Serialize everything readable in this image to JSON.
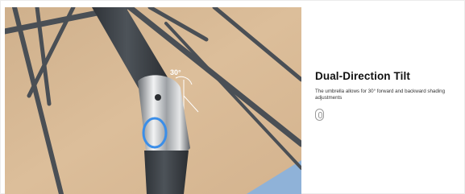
{
  "feature": {
    "title": "Dual-Direction Tilt",
    "description": "The umbrella allows for 30° forward and backward shading adjustments",
    "toggle_icon": "switch-toggle-icon"
  },
  "photo": {
    "angle_label": "30°",
    "canopy_color": "#d8b893",
    "frame_color": "#4a4f55",
    "highlight_color": "#3b8ee8"
  }
}
